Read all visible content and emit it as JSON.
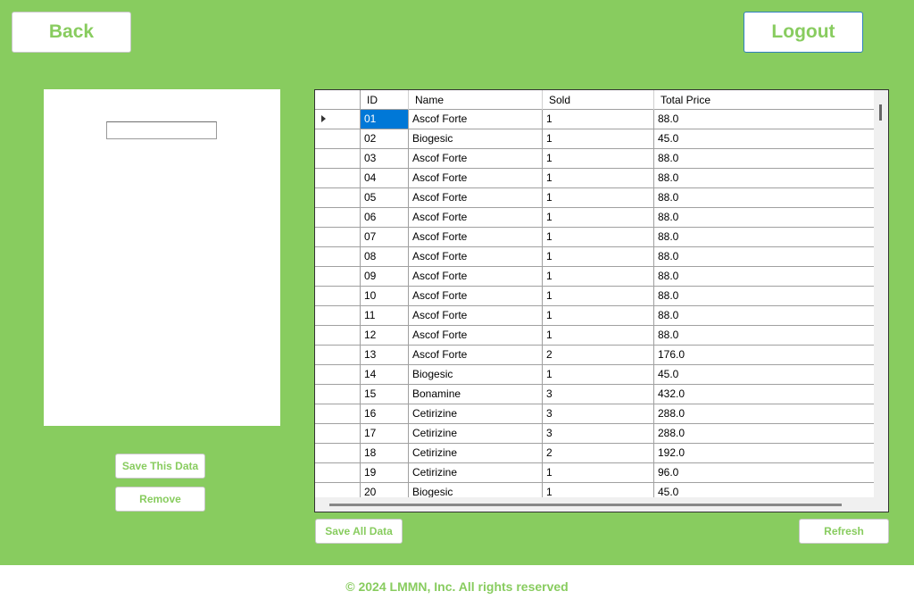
{
  "header": {
    "back_label": "Back",
    "logout_label": "Logout"
  },
  "left_panel": {
    "input_value": "",
    "save_this_label": "Save This Data",
    "remove_label": "Remove"
  },
  "grid": {
    "columns": [
      "ID",
      "Name",
      "Sold",
      "Total Price"
    ],
    "selected_row": 0,
    "rows": [
      [
        "01",
        "Ascof Forte",
        "1",
        "88.0"
      ],
      [
        "02",
        "Biogesic",
        "1",
        "45.0"
      ],
      [
        "03",
        "Ascof Forte",
        "1",
        "88.0"
      ],
      [
        "04",
        "Ascof Forte",
        "1",
        "88.0"
      ],
      [
        "05",
        "Ascof Forte",
        "1",
        "88.0"
      ],
      [
        "06",
        "Ascof Forte",
        "1",
        "88.0"
      ],
      [
        "07",
        "Ascof Forte",
        "1",
        "88.0"
      ],
      [
        "08",
        "Ascof Forte",
        "1",
        "88.0"
      ],
      [
        "09",
        "Ascof Forte",
        "1",
        "88.0"
      ],
      [
        "10",
        "Ascof Forte",
        "1",
        "88.0"
      ],
      [
        "11",
        "Ascof Forte",
        "1",
        "88.0"
      ],
      [
        "12",
        "Ascof Forte",
        "1",
        "88.0"
      ],
      [
        "13",
        "Ascof Forte",
        "2",
        "176.0"
      ],
      [
        "14",
        "Biogesic",
        "1",
        "45.0"
      ],
      [
        "15",
        "Bonamine",
        "3",
        "432.0"
      ],
      [
        "16",
        "Cetirizine",
        "3",
        "288.0"
      ],
      [
        "17",
        "Cetirizine",
        "3",
        "288.0"
      ],
      [
        "18",
        "Cetirizine",
        "2",
        "192.0"
      ],
      [
        "19",
        "Cetirizine",
        "1",
        "96.0"
      ],
      [
        "20",
        "Biogesic",
        "1",
        "45.0"
      ]
    ]
  },
  "bottom": {
    "save_all_label": "Save All Data",
    "refresh_label": "Refresh"
  },
  "footer": {
    "text": "© 2024 LMMN, Inc. All rights reserved"
  },
  "colors": {
    "accent": "#88cc5f",
    "selection": "#0078d7",
    "logout_border": "#2f7fbf"
  }
}
